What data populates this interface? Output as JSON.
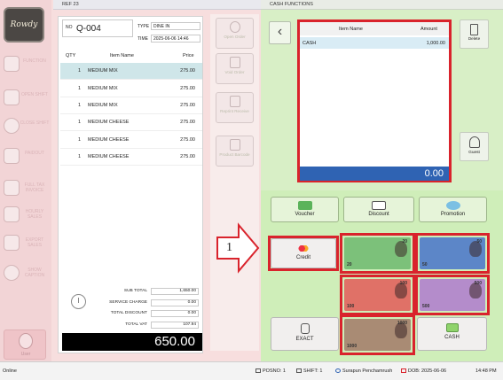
{
  "sidebar": {
    "logo_text": "Rowdy",
    "buttons": [
      {
        "name": "function",
        "label": "FUNCTION"
      },
      {
        "name": "open-shift",
        "label": "OPEN SHIFT"
      },
      {
        "name": "close-shift",
        "label": "CLOSE SHIFT"
      },
      {
        "name": "paidout",
        "label": "PAIDOUT"
      },
      {
        "name": "full-tax-invoice",
        "label": "FULL TAX INVOICE"
      },
      {
        "name": "hourly-sales",
        "label": "HOURLY SALES"
      },
      {
        "name": "export-sales",
        "label": "EXPORT SALES"
      },
      {
        "name": "show-caption",
        "label": "SHOW CAPTION"
      }
    ],
    "user_label": "User"
  },
  "order": {
    "header_title": "REF 23",
    "no_label": "NO",
    "order_no": "Q-004",
    "type_label": "TYPE",
    "type_value": "DINE IN",
    "time_label": "TIME",
    "time_value": "2025-06-06 14:46",
    "columns": {
      "qty": "QTY",
      "item": "Item Name",
      "price": "Price"
    },
    "items": [
      {
        "qty": "1",
        "name": "MEDIUM MIX",
        "price": "275.00"
      },
      {
        "qty": "1",
        "name": "MEDIUM MIX",
        "price": "275.00"
      },
      {
        "qty": "1",
        "name": "MEDIUM MIX",
        "price": "275.00"
      },
      {
        "qty": "1",
        "name": "MEDIUM CHEESE",
        "price": "275.00"
      },
      {
        "qty": "1",
        "name": "MEDIUM CHEESE",
        "price": "275.00"
      },
      {
        "qty": "1",
        "name": "MEDIUM CHEESE",
        "price": "275.00"
      }
    ],
    "totals": {
      "sub_total_label": "SUB TOTAL",
      "sub_total": "1,650.00",
      "service_label": "SERVICE CHARGE",
      "service": "0.00",
      "discount_label": "TOTAL DISCOUNT",
      "discount": "0.00",
      "vat_label": "TOTAL VAT",
      "vat": "107.94"
    },
    "grand_total": "650.00"
  },
  "middle_actions": [
    {
      "name": "open-order",
      "label": "Open Order"
    },
    {
      "name": "void-order",
      "label": "Void Order"
    },
    {
      "name": "reprint-receive",
      "label": "Reprint Receive"
    },
    {
      "name": "product-barcode",
      "label": "Product Barcode"
    }
  ],
  "cash": {
    "header_title": "CASH FUNCTIONS",
    "columns": {
      "item": "Item Name",
      "amount": "Amount"
    },
    "rows": [
      {
        "item": "CASH",
        "amount": "1,000.00"
      }
    ],
    "total": "0.00",
    "delete_label": "Delete",
    "guest_label": "Guest",
    "voucher_label": "Voucher",
    "discount_label": "Discount",
    "promotion_label": "Promotion",
    "credit_label": "Credit",
    "exact_label": "EXACT",
    "cash_label": "CASH",
    "banknotes": [
      {
        "value": "20",
        "color": "#6db56a"
      },
      {
        "value": "50",
        "color": "#3d6fb8"
      },
      {
        "value": "100",
        "color": "#d1504a"
      },
      {
        "value": "500",
        "color": "#9b6fb4"
      },
      {
        "value": "1000",
        "color": "#9a7a64"
      }
    ]
  },
  "annotation": {
    "number": "1"
  },
  "status": {
    "state": "Online",
    "posno": "POSNO: 1",
    "shift": "SHIFT: 1",
    "user": "Surapun Penchamrush",
    "dob": "DOB: 2025-06-06",
    "time": "14:48 PM"
  },
  "colors": {
    "highlight_red": "#d9232c",
    "total_blue": "#2f63b3",
    "panel_green": "#d8efc6"
  }
}
